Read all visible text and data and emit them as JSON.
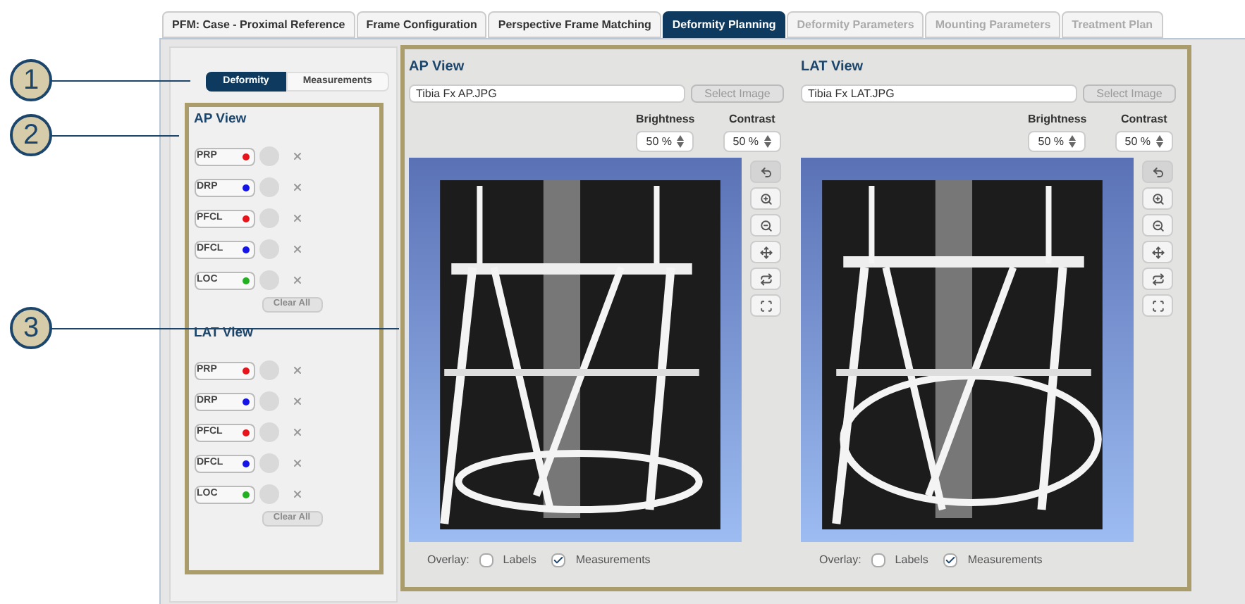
{
  "tabs": [
    {
      "label": "PFM: Case - Proximal Reference",
      "selected": false,
      "disabled": false
    },
    {
      "label": "Frame Configuration",
      "selected": false,
      "disabled": false
    },
    {
      "label": "Perspective Frame Matching",
      "selected": false,
      "disabled": false
    },
    {
      "label": "Deformity Planning",
      "selected": true,
      "disabled": false
    },
    {
      "label": "Deformity Parameters",
      "selected": false,
      "disabled": true
    },
    {
      "label": "Mounting Parameters",
      "selected": false,
      "disabled": true
    },
    {
      "label": "Treatment Plan",
      "selected": false,
      "disabled": true
    }
  ],
  "callouts": [
    "1",
    "2",
    "3"
  ],
  "mode_toggle": [
    {
      "label": "Deformity",
      "selected": true
    },
    {
      "label": "Measurements",
      "selected": false
    }
  ],
  "point_groups": [
    {
      "title": "AP View",
      "clear": "Clear All",
      "points": [
        {
          "label": "PRP",
          "color": "#e8141c"
        },
        {
          "label": "DRP",
          "color": "#1414e8"
        },
        {
          "label": "PFCL",
          "color": "#e8141c"
        },
        {
          "label": "DFCL",
          "color": "#1414e8"
        },
        {
          "label": "LOC",
          "color": "#22b022"
        }
      ]
    },
    {
      "title": "LAT View",
      "clear": "Clear All",
      "points": [
        {
          "label": "PRP",
          "color": "#e8141c"
        },
        {
          "label": "DRP",
          "color": "#1414e8"
        },
        {
          "label": "PFCL",
          "color": "#e8141c"
        },
        {
          "label": "DFCL",
          "color": "#1414e8"
        },
        {
          "label": "LOC",
          "color": "#22b022"
        }
      ]
    }
  ],
  "views": [
    {
      "title": "AP View",
      "file": "Tibia Fx AP.JPG",
      "select": "Select Image",
      "brightness": {
        "label": "Brightness",
        "value": "50 %"
      },
      "contrast": {
        "label": "Contrast",
        "value": "50 %"
      },
      "overlay": {
        "label": "Overlay:",
        "options": [
          {
            "label": "Labels",
            "checked": false
          },
          {
            "label": "Measurements",
            "checked": true
          }
        ]
      }
    },
    {
      "title": "LAT View",
      "file": "Tibia Fx LAT.JPG",
      "select": "Select Image",
      "brightness": {
        "label": "Brightness",
        "value": "50 %"
      },
      "contrast": {
        "label": "Contrast",
        "value": "50 %"
      },
      "overlay": {
        "label": "Overlay:",
        "options": [
          {
            "label": "Labels",
            "checked": false
          },
          {
            "label": "Measurements",
            "checked": true
          }
        ]
      }
    }
  ]
}
